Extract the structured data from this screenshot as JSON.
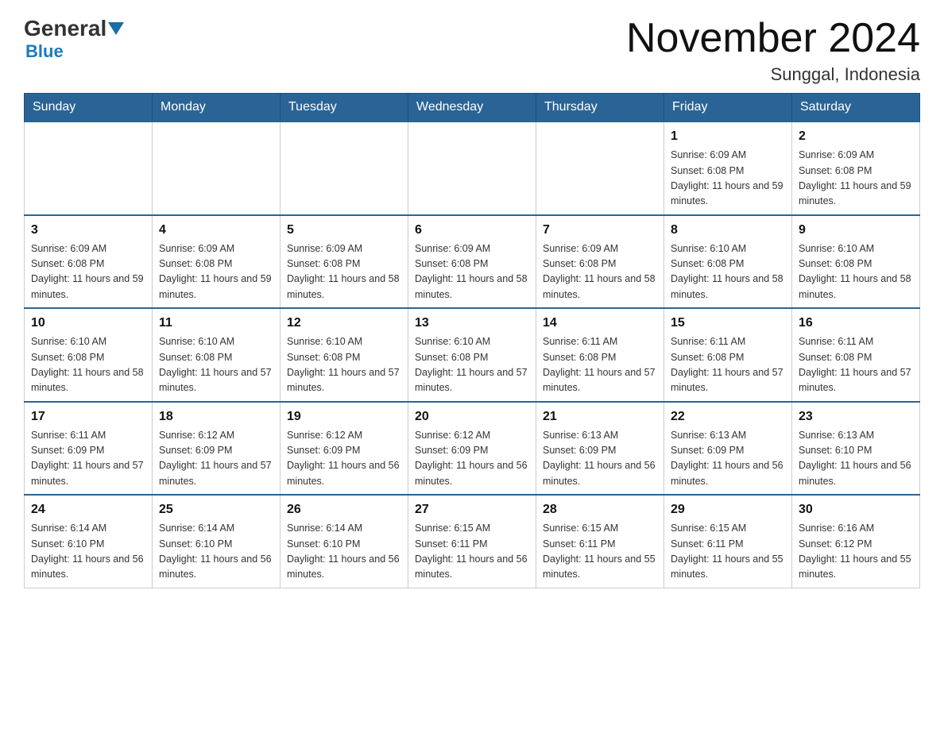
{
  "header": {
    "logo": {
      "general": "General",
      "blue": "Blue"
    },
    "title": "November 2024",
    "location": "Sunggal, Indonesia"
  },
  "days_of_week": [
    "Sunday",
    "Monday",
    "Tuesday",
    "Wednesday",
    "Thursday",
    "Friday",
    "Saturday"
  ],
  "weeks": [
    [
      {
        "day": "",
        "info": ""
      },
      {
        "day": "",
        "info": ""
      },
      {
        "day": "",
        "info": ""
      },
      {
        "day": "",
        "info": ""
      },
      {
        "day": "",
        "info": ""
      },
      {
        "day": "1",
        "info": "Sunrise: 6:09 AM\nSunset: 6:08 PM\nDaylight: 11 hours and 59 minutes."
      },
      {
        "day": "2",
        "info": "Sunrise: 6:09 AM\nSunset: 6:08 PM\nDaylight: 11 hours and 59 minutes."
      }
    ],
    [
      {
        "day": "3",
        "info": "Sunrise: 6:09 AM\nSunset: 6:08 PM\nDaylight: 11 hours and 59 minutes."
      },
      {
        "day": "4",
        "info": "Sunrise: 6:09 AM\nSunset: 6:08 PM\nDaylight: 11 hours and 59 minutes."
      },
      {
        "day": "5",
        "info": "Sunrise: 6:09 AM\nSunset: 6:08 PM\nDaylight: 11 hours and 58 minutes."
      },
      {
        "day": "6",
        "info": "Sunrise: 6:09 AM\nSunset: 6:08 PM\nDaylight: 11 hours and 58 minutes."
      },
      {
        "day": "7",
        "info": "Sunrise: 6:09 AM\nSunset: 6:08 PM\nDaylight: 11 hours and 58 minutes."
      },
      {
        "day": "8",
        "info": "Sunrise: 6:10 AM\nSunset: 6:08 PM\nDaylight: 11 hours and 58 minutes."
      },
      {
        "day": "9",
        "info": "Sunrise: 6:10 AM\nSunset: 6:08 PM\nDaylight: 11 hours and 58 minutes."
      }
    ],
    [
      {
        "day": "10",
        "info": "Sunrise: 6:10 AM\nSunset: 6:08 PM\nDaylight: 11 hours and 58 minutes."
      },
      {
        "day": "11",
        "info": "Sunrise: 6:10 AM\nSunset: 6:08 PM\nDaylight: 11 hours and 57 minutes."
      },
      {
        "day": "12",
        "info": "Sunrise: 6:10 AM\nSunset: 6:08 PM\nDaylight: 11 hours and 57 minutes."
      },
      {
        "day": "13",
        "info": "Sunrise: 6:10 AM\nSunset: 6:08 PM\nDaylight: 11 hours and 57 minutes."
      },
      {
        "day": "14",
        "info": "Sunrise: 6:11 AM\nSunset: 6:08 PM\nDaylight: 11 hours and 57 minutes."
      },
      {
        "day": "15",
        "info": "Sunrise: 6:11 AM\nSunset: 6:08 PM\nDaylight: 11 hours and 57 minutes."
      },
      {
        "day": "16",
        "info": "Sunrise: 6:11 AM\nSunset: 6:08 PM\nDaylight: 11 hours and 57 minutes."
      }
    ],
    [
      {
        "day": "17",
        "info": "Sunrise: 6:11 AM\nSunset: 6:09 PM\nDaylight: 11 hours and 57 minutes."
      },
      {
        "day": "18",
        "info": "Sunrise: 6:12 AM\nSunset: 6:09 PM\nDaylight: 11 hours and 57 minutes."
      },
      {
        "day": "19",
        "info": "Sunrise: 6:12 AM\nSunset: 6:09 PM\nDaylight: 11 hours and 56 minutes."
      },
      {
        "day": "20",
        "info": "Sunrise: 6:12 AM\nSunset: 6:09 PM\nDaylight: 11 hours and 56 minutes."
      },
      {
        "day": "21",
        "info": "Sunrise: 6:13 AM\nSunset: 6:09 PM\nDaylight: 11 hours and 56 minutes."
      },
      {
        "day": "22",
        "info": "Sunrise: 6:13 AM\nSunset: 6:09 PM\nDaylight: 11 hours and 56 minutes."
      },
      {
        "day": "23",
        "info": "Sunrise: 6:13 AM\nSunset: 6:10 PM\nDaylight: 11 hours and 56 minutes."
      }
    ],
    [
      {
        "day": "24",
        "info": "Sunrise: 6:14 AM\nSunset: 6:10 PM\nDaylight: 11 hours and 56 minutes."
      },
      {
        "day": "25",
        "info": "Sunrise: 6:14 AM\nSunset: 6:10 PM\nDaylight: 11 hours and 56 minutes."
      },
      {
        "day": "26",
        "info": "Sunrise: 6:14 AM\nSunset: 6:10 PM\nDaylight: 11 hours and 56 minutes."
      },
      {
        "day": "27",
        "info": "Sunrise: 6:15 AM\nSunset: 6:11 PM\nDaylight: 11 hours and 56 minutes."
      },
      {
        "day": "28",
        "info": "Sunrise: 6:15 AM\nSunset: 6:11 PM\nDaylight: 11 hours and 55 minutes."
      },
      {
        "day": "29",
        "info": "Sunrise: 6:15 AM\nSunset: 6:11 PM\nDaylight: 11 hours and 55 minutes."
      },
      {
        "day": "30",
        "info": "Sunrise: 6:16 AM\nSunset: 6:12 PM\nDaylight: 11 hours and 55 minutes."
      }
    ]
  ]
}
